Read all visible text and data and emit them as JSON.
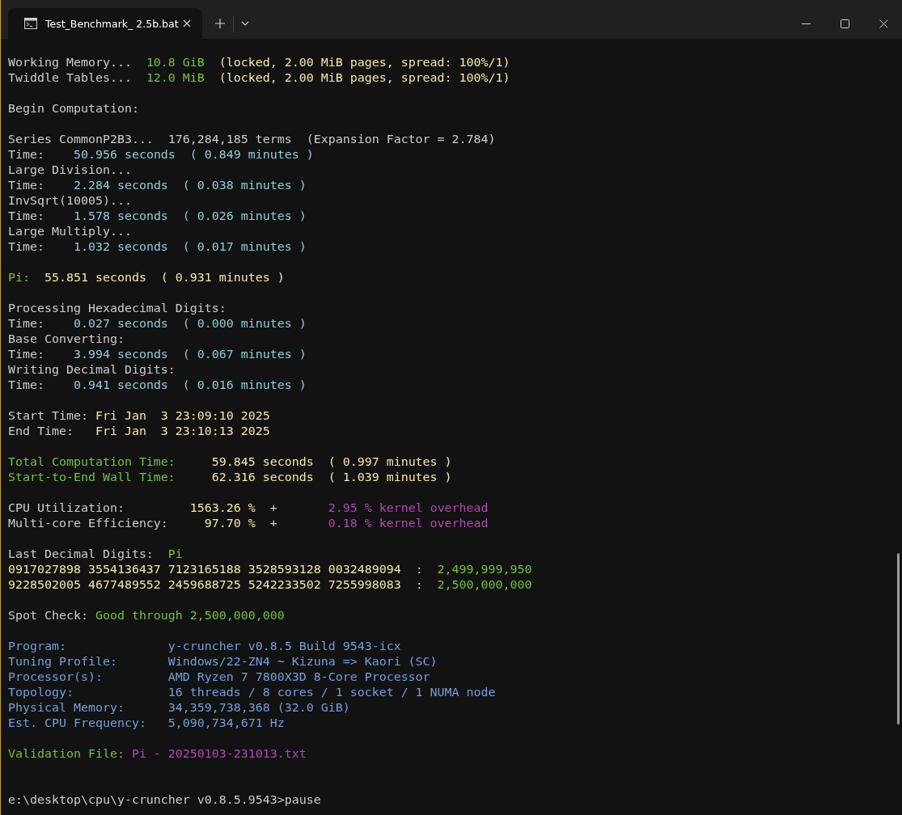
{
  "window": {
    "tab": {
      "title": "Test_Benchmark_ 2.5b.bat",
      "selected": true
    }
  },
  "lines": [
    {
      "kind": "text",
      "segments": [
        {
          "text": "Working Memory...  ",
          "color": "#cccccc"
        },
        {
          "text": "10.8 GiB",
          "color": "#72c13a"
        },
        {
          "text": "  (locked, 2.00 MiB pages, spread: 100%/1)",
          "color": "#f1e9a2"
        }
      ]
    },
    {
      "kind": "text",
      "segments": [
        {
          "text": "Twiddle Tables...  ",
          "color": "#cccccc"
        },
        {
          "text": "12.0 MiB",
          "color": "#72c13a"
        },
        {
          "text": "  (locked, 2.00 MiB pages, spread: 100%/1)",
          "color": "#f1e9a2"
        }
      ]
    },
    {
      "kind": "blank"
    },
    {
      "kind": "text",
      "segments": [
        {
          "text": "Begin Computation:",
          "color": "#cccccc"
        }
      ]
    },
    {
      "kind": "blank"
    },
    {
      "kind": "text",
      "segments": [
        {
          "text": "Series CommonP2B3...  176,284,185 terms  (Expansion Factor = 2.784)",
          "color": "#cccccc"
        }
      ]
    },
    {
      "kind": "text",
      "segments": [
        {
          "text": "Time:    ",
          "color": "#cccccc"
        },
        {
          "text": "50.956 seconds  ( 0.849 minutes )",
          "color": "#8ccfd6"
        }
      ]
    },
    {
      "kind": "text",
      "segments": [
        {
          "text": "Large Division...",
          "color": "#cccccc"
        }
      ]
    },
    {
      "kind": "text",
      "segments": [
        {
          "text": "Time:    ",
          "color": "#cccccc"
        },
        {
          "text": "2.284 seconds  ( 0.038 minutes )",
          "color": "#8ccfd6"
        }
      ]
    },
    {
      "kind": "text",
      "segments": [
        {
          "text": "InvSqrt(10005)...",
          "color": "#cccccc"
        }
      ]
    },
    {
      "kind": "text",
      "segments": [
        {
          "text": "Time:    ",
          "color": "#cccccc"
        },
        {
          "text": "1.578 seconds  ( 0.026 minutes )",
          "color": "#8ccfd6"
        }
      ]
    },
    {
      "kind": "text",
      "segments": [
        {
          "text": "Large Multiply...",
          "color": "#cccccc"
        }
      ]
    },
    {
      "kind": "text",
      "segments": [
        {
          "text": "Time:    ",
          "color": "#cccccc"
        },
        {
          "text": "1.032 seconds  ( 0.017 minutes )",
          "color": "#8ccfd6"
        }
      ]
    },
    {
      "kind": "blank"
    },
    {
      "kind": "text",
      "segments": [
        {
          "text": "Pi:  ",
          "color": "#72c13a"
        },
        {
          "text": "55.851 seconds  ( 0.931 minutes )",
          "color": "#f1e9a2"
        }
      ]
    },
    {
      "kind": "blank"
    },
    {
      "kind": "text",
      "segments": [
        {
          "text": "Processing Hexadecimal Digits:",
          "color": "#cccccc"
        }
      ]
    },
    {
      "kind": "text",
      "segments": [
        {
          "text": "Time:    ",
          "color": "#cccccc"
        },
        {
          "text": "0.027 seconds  ( 0.000 minutes )",
          "color": "#8ccfd6"
        }
      ]
    },
    {
      "kind": "text",
      "segments": [
        {
          "text": "Base Converting:",
          "color": "#cccccc"
        }
      ]
    },
    {
      "kind": "text",
      "segments": [
        {
          "text": "Time:    ",
          "color": "#cccccc"
        },
        {
          "text": "3.994 seconds  ( 0.067 minutes )",
          "color": "#8ccfd6"
        }
      ]
    },
    {
      "kind": "text",
      "segments": [
        {
          "text": "Writing Decimal Digits:",
          "color": "#cccccc"
        }
      ]
    },
    {
      "kind": "text",
      "segments": [
        {
          "text": "Time:    ",
          "color": "#cccccc"
        },
        {
          "text": "0.941 seconds  ( 0.016 minutes )",
          "color": "#8ccfd6"
        }
      ]
    },
    {
      "kind": "blank"
    },
    {
      "kind": "text",
      "segments": [
        {
          "text": "Start Time: ",
          "color": "#cccccc"
        },
        {
          "text": "Fri Jan  3 23:09:10 2025",
          "color": "#f1e9a2"
        }
      ]
    },
    {
      "kind": "text",
      "segments": [
        {
          "text": "End Time:   ",
          "color": "#cccccc"
        },
        {
          "text": "Fri Jan  3 23:10:13 2025",
          "color": "#f1e9a2"
        }
      ]
    },
    {
      "kind": "blank"
    },
    {
      "kind": "text",
      "segments": [
        {
          "text": "Total Computation Time:     ",
          "color": "#72c13a"
        },
        {
          "text": "59.845 seconds  ( 0.997 minutes )",
          "color": "#f1e9a2"
        }
      ]
    },
    {
      "kind": "text",
      "segments": [
        {
          "text": "Start-to-End Wall Time:     ",
          "color": "#72c13a"
        },
        {
          "text": "62.316 seconds  ( 1.039 minutes )",
          "color": "#f1e9a2"
        }
      ]
    },
    {
      "kind": "blank"
    },
    {
      "kind": "text",
      "segments": [
        {
          "text": "CPU Utilization:         ",
          "color": "#cccccc"
        },
        {
          "text": "1563.26 %",
          "color": "#f1e9a2"
        },
        {
          "text": "  +       ",
          "color": "#cccccc"
        },
        {
          "text": "2.95 % kernel overhead",
          "color": "#b146b6"
        }
      ]
    },
    {
      "kind": "text",
      "segments": [
        {
          "text": "Multi-core Efficiency:     ",
          "color": "#cccccc"
        },
        {
          "text": "97.70 %",
          "color": "#f1e9a2"
        },
        {
          "text": "  +       ",
          "color": "#cccccc"
        },
        {
          "text": "0.18 % kernel overhead",
          "color": "#b146b6"
        }
      ]
    },
    {
      "kind": "blank"
    },
    {
      "kind": "text",
      "segments": [
        {
          "text": "Last Decimal Digits:  ",
          "color": "#cccccc"
        },
        {
          "text": "Pi",
          "color": "#72c13a"
        }
      ]
    },
    {
      "kind": "text",
      "segments": [
        {
          "text": "0917027898 3554136437 7123165188 3528593128 0032489094",
          "color": "#f1e9a2"
        },
        {
          "text": "  :  ",
          "color": "#cccccc"
        },
        {
          "text": "2,499,999,950",
          "color": "#72c13a"
        }
      ]
    },
    {
      "kind": "text",
      "segments": [
        {
          "text": "9228502005 4677489552 2459688725 5242233502 7255998083",
          "color": "#f1e9a2"
        },
        {
          "text": "  :  ",
          "color": "#cccccc"
        },
        {
          "text": "2,500,000,000",
          "color": "#72c13a"
        }
      ]
    },
    {
      "kind": "blank"
    },
    {
      "kind": "text",
      "segments": [
        {
          "text": "Spot Check: ",
          "color": "#cccccc"
        },
        {
          "text": "Good through 2,500,000,000",
          "color": "#72c13a"
        }
      ]
    },
    {
      "kind": "blank"
    },
    {
      "kind": "text",
      "segments": [
        {
          "text": "Program:              y-cruncher v0.8.5 Build 9543-icx",
          "color": "#6f9fe3"
        }
      ]
    },
    {
      "kind": "text",
      "segments": [
        {
          "text": "Tuning Profile:       Windows/22-ZN4 ~ Kizuna => Kaori (SC)",
          "color": "#6f9fe3"
        }
      ]
    },
    {
      "kind": "text",
      "segments": [
        {
          "text": "Processor(s):         AMD Ryzen 7 7800X3D 8-Core Processor",
          "color": "#6f9fe3"
        }
      ]
    },
    {
      "kind": "text",
      "segments": [
        {
          "text": "Topology:             16 threads / 8 cores / 1 socket / 1 NUMA node",
          "color": "#6f9fe3"
        }
      ]
    },
    {
      "kind": "text",
      "segments": [
        {
          "text": "Physical Memory:      34,359,738,368 (32.0 GiB)",
          "color": "#6f9fe3"
        }
      ]
    },
    {
      "kind": "text",
      "segments": [
        {
          "text": "Est. CPU Frequency:   5,090,734,671 Hz",
          "color": "#6f9fe3"
        }
      ]
    },
    {
      "kind": "blank"
    },
    {
      "kind": "text",
      "segments": [
        {
          "text": "Validation File: ",
          "color": "#72c13a"
        },
        {
          "text": "Pi - 20250103-231013.txt",
          "color": "#b146b6"
        }
      ]
    },
    {
      "kind": "blank"
    },
    {
      "kind": "blank"
    },
    {
      "kind": "text",
      "segments": [
        {
          "text": "e:\\desktop\\cpu\\y-cruncher v0.8.5.9543>pause",
          "color": "#cccccc"
        }
      ]
    }
  ]
}
